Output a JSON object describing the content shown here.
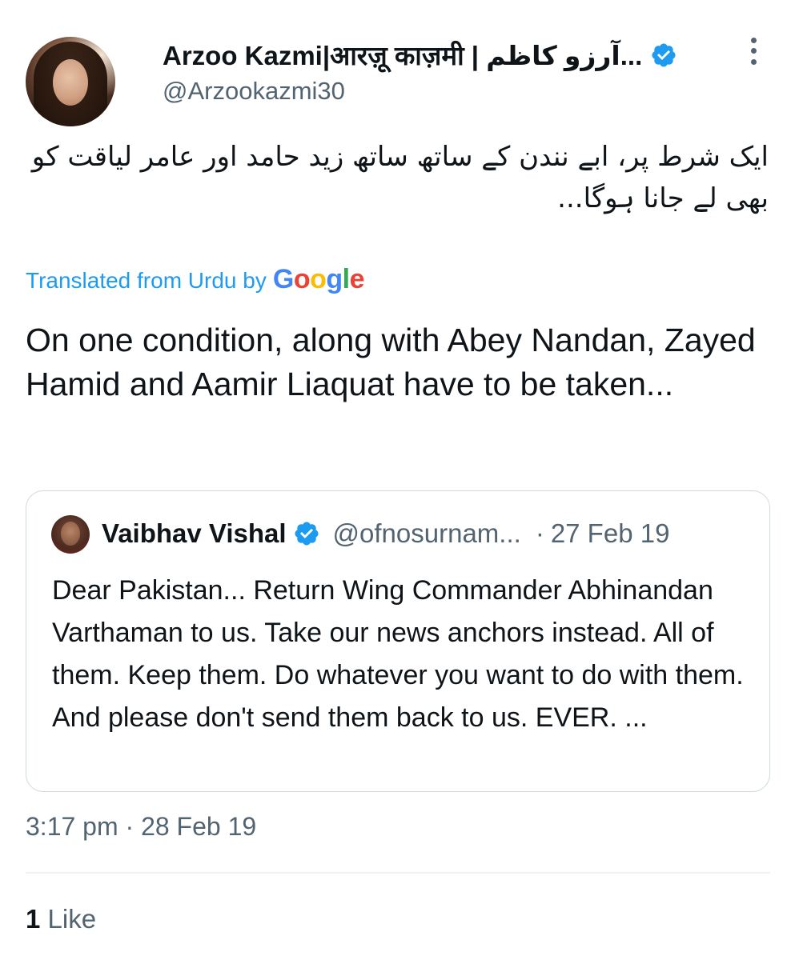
{
  "author": {
    "display_name": "Arzoo Kazmi|आरज़ू काज़मी | آرزو کاظم...",
    "handle": "@Arzookazmi30",
    "verified": true
  },
  "tweet": {
    "urdu_text": "ایک شرط پر، ابے نندن کے ساتھ ساتھ زید حامد اور عامر لیاقت کو بھی لے جانا ہوگا...",
    "translated_label": "Translated from Urdu by",
    "google_brand": "Google",
    "translation": "On one condition, along with Abey Nandan, Zayed Hamid and Aamir Liaquat have to be taken...",
    "timestamp": "3:17 pm · 28 Feb 19",
    "like_count": "1",
    "like_label": "Like"
  },
  "quoted_tweet": {
    "display_name": "Vaibhav Vishal",
    "handle": "@ofnosurnam...",
    "separator": "·",
    "date": "27 Feb 19",
    "text": "Dear Pakistan... Return Wing Commander Abhinandan Varthaman to us. Take our news anchors instead. All of them. Keep them. Do whatever you want to do with them. And please don't send them back to us. EVER. ..."
  },
  "colors": {
    "accent": "#1d9bf0",
    "secondary_text": "#536471",
    "primary_text": "#0f1419",
    "border": "#cfd9de"
  },
  "icons": [
    "verified-badge-icon",
    "more-options-icon"
  ]
}
